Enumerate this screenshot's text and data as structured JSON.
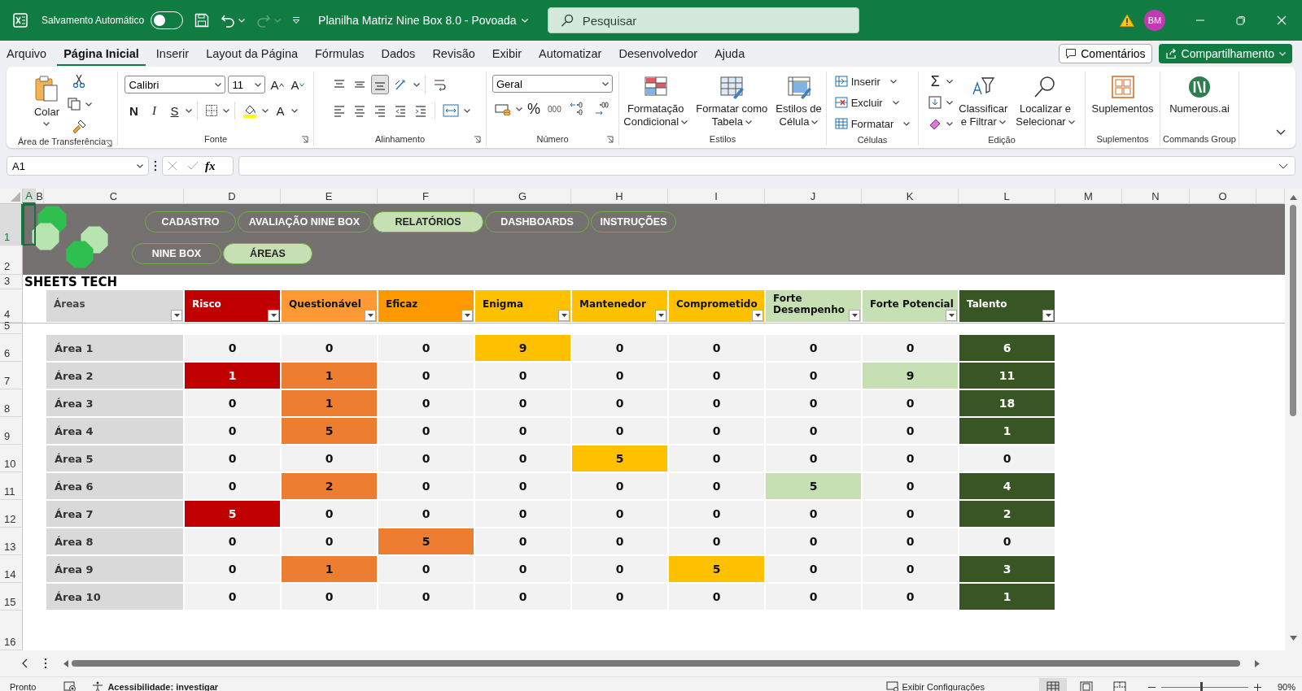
{
  "title_bar": {
    "autosave_label": "Salvamento Automático",
    "autosave_on": false,
    "redo_disabled": true,
    "document_title": "Planilha Matriz Nine Box 8.0 - Povoada",
    "search": {
      "placeholder": "Pesquisar"
    },
    "avatar": "BM"
  },
  "menu_tabs": [
    {
      "label": "Arquivo",
      "selected": false
    },
    {
      "label": "Página Inicial",
      "selected": true
    },
    {
      "label": "Inserir",
      "selected": false
    },
    {
      "label": "Layout da Página",
      "selected": false
    },
    {
      "label": "Fórmulas",
      "selected": false
    },
    {
      "label": "Dados",
      "selected": false
    },
    {
      "label": "Revisão",
      "selected": false
    },
    {
      "label": "Exibir",
      "selected": false
    },
    {
      "label": "Automatizar",
      "selected": false
    },
    {
      "label": "Desenvolvedor",
      "selected": false
    },
    {
      "label": "Ajuda",
      "selected": false
    }
  ],
  "comments_button": "Comentários",
  "share_button": "Compartilhamento",
  "ribbon": {
    "clipboard": {
      "label": "Área de Transferência",
      "paste": "Colar"
    },
    "font": {
      "label": "Fonte",
      "font_name": "Calibri",
      "font_size": "11",
      "grow": "A",
      "shrink": "A",
      "bold": "N",
      "italic": "I",
      "underline": "S",
      "font_color": "A"
    },
    "alignment": {
      "label": "Alinhamento",
      "vertical": [
        {
          "kind": "top",
          "selected": false
        },
        {
          "kind": "middle",
          "selected": false
        },
        {
          "kind": "bottom",
          "selected": true
        }
      ]
    },
    "number": {
      "label": "Número",
      "format": "Geral",
      "percent": "%",
      "thousands": "000"
    },
    "styles": {
      "label": "Estilos",
      "buttons": [
        {
          "kind": "conditional",
          "lines": [
            "Formatação",
            "Condicional"
          ]
        },
        {
          "kind": "table",
          "lines": [
            "Formatar como",
            "Tabela"
          ]
        },
        {
          "kind": "cell",
          "lines": [
            "Estilos de",
            "Célula"
          ]
        }
      ]
    },
    "cells": {
      "label": "Células",
      "buttons": [
        {
          "kind": "insert",
          "label": "Inserir"
        },
        {
          "kind": "delete",
          "label": "Excluir"
        },
        {
          "kind": "format",
          "label": "Formatar"
        }
      ]
    },
    "editing": {
      "label": "Edição",
      "sum": "Σ",
      "sort": [
        "Classificar",
        "e Filtrar"
      ],
      "find": [
        "Localizar e",
        "Selecionar"
      ]
    },
    "addins": {
      "label": "Suplementos",
      "button": "Suplementos"
    },
    "commands": {
      "label": "Commands Group",
      "button": "Numerous.ai"
    }
  },
  "formula_bar": {
    "name_box": "A1",
    "fx": "fx"
  },
  "sheet": {
    "column_headers": [
      {
        "label": "A",
        "selected": true
      },
      {
        "label": "B",
        "selected": false
      },
      {
        "label": "C",
        "selected": false
      },
      {
        "label": "D",
        "selected": false
      },
      {
        "label": "E",
        "selected": false
      },
      {
        "label": "F",
        "selected": false
      },
      {
        "label": "G",
        "selected": false
      },
      {
        "label": "H",
        "selected": false
      },
      {
        "label": "I",
        "selected": false
      },
      {
        "label": "J",
        "selected": false
      },
      {
        "label": "K",
        "selected": false
      },
      {
        "label": "L",
        "selected": false
      },
      {
        "label": "M",
        "selected": false
      },
      {
        "label": "N",
        "selected": false
      },
      {
        "label": "O",
        "selected": false
      }
    ],
    "row_headers": [
      {
        "label": "1",
        "selected": true
      },
      {
        "label": "2",
        "selected": false
      },
      {
        "label": "3",
        "selected": false
      },
      {
        "label": "4",
        "selected": false
      },
      {
        "label": "5",
        "selected": false
      },
      {
        "label": "6",
        "selected": false
      },
      {
        "label": "7",
        "selected": false
      },
      {
        "label": "8",
        "selected": false
      },
      {
        "label": "9",
        "selected": false
      },
      {
        "label": "10",
        "selected": false
      },
      {
        "label": "11",
        "selected": false
      },
      {
        "label": "12",
        "selected": false
      },
      {
        "label": "13",
        "selected": false
      },
      {
        "label": "14",
        "selected": false
      },
      {
        "label": "15",
        "selected": false
      },
      {
        "label": "16",
        "selected": false
      }
    ],
    "nav_primary": [
      {
        "label": "CADASTRO",
        "selected": false
      },
      {
        "label": "AVALIAÇÃO NINE BOX",
        "selected": false
      },
      {
        "label": "RELATÓRIOS",
        "selected": true
      },
      {
        "label": "DASHBOARDS",
        "selected": false
      },
      {
        "label": "INSTRUÇÕES",
        "selected": false
      }
    ],
    "nav_secondary": [
      {
        "label": "NINE BOX",
        "selected": false
      },
      {
        "label": "ÁREAS",
        "selected": true
      }
    ],
    "brand": "SHEETS TECH",
    "table": {
      "area_heading": {
        "label": "Áreas",
        "color": "#d9d9d9"
      },
      "columns": [
        {
          "label": "Risco",
          "color": "#c00000"
        },
        {
          "label": "Questionável",
          "color": "#ff9933"
        },
        {
          "label": "Eficaz",
          "color": "#ff9900"
        },
        {
          "label": "Enigma",
          "color": "#ffc000"
        },
        {
          "label": "Mantenedor",
          "color": "#ffc000"
        },
        {
          "label": "Comprometido",
          "color": "#ffc000"
        },
        {
          "label": "Forte Desempenho",
          "color": "#c6e0b4"
        },
        {
          "label": "Forte Potencial",
          "color": "#c6e0b4"
        },
        {
          "label": "Talento",
          "color": "#375623"
        }
      ],
      "rows": [
        {
          "area": "Área 1",
          "cells": [
            {
              "value": "0",
              "color": "#f2f2f2"
            },
            {
              "value": "0",
              "color": "#f2f2f2"
            },
            {
              "value": "0",
              "color": "#f2f2f2"
            },
            {
              "value": "9",
              "color": "#ffc000"
            },
            {
              "value": "0",
              "color": "#f2f2f2"
            },
            {
              "value": "0",
              "color": "#f2f2f2"
            },
            {
              "value": "0",
              "color": "#f2f2f2"
            },
            {
              "value": "0",
              "color": "#f2f2f2"
            },
            {
              "value": "6",
              "color": "#375623"
            }
          ]
        },
        {
          "area": "Área 2",
          "cells": [
            {
              "value": "1",
              "color": "#c00000"
            },
            {
              "value": "1",
              "color": "#ed7d31"
            },
            {
              "value": "0",
              "color": "#f2f2f2"
            },
            {
              "value": "0",
              "color": "#f2f2f2"
            },
            {
              "value": "0",
              "color": "#f2f2f2"
            },
            {
              "value": "0",
              "color": "#f2f2f2"
            },
            {
              "value": "0",
              "color": "#f2f2f2"
            },
            {
              "value": "9",
              "color": "#c6e0b4"
            },
            {
              "value": "11",
              "color": "#375623"
            }
          ]
        },
        {
          "area": "Área 3",
          "cells": [
            {
              "value": "0",
              "color": "#f2f2f2"
            },
            {
              "value": "1",
              "color": "#ed7d31"
            },
            {
              "value": "0",
              "color": "#f2f2f2"
            },
            {
              "value": "0",
              "color": "#f2f2f2"
            },
            {
              "value": "0",
              "color": "#f2f2f2"
            },
            {
              "value": "0",
              "color": "#f2f2f2"
            },
            {
              "value": "0",
              "color": "#f2f2f2"
            },
            {
              "value": "0",
              "color": "#f2f2f2"
            },
            {
              "value": "18",
              "color": "#375623"
            }
          ]
        },
        {
          "area": "Área 4",
          "cells": [
            {
              "value": "0",
              "color": "#f2f2f2"
            },
            {
              "value": "5",
              "color": "#ed7d31"
            },
            {
              "value": "0",
              "color": "#f2f2f2"
            },
            {
              "value": "0",
              "color": "#f2f2f2"
            },
            {
              "value": "0",
              "color": "#f2f2f2"
            },
            {
              "value": "0",
              "color": "#f2f2f2"
            },
            {
              "value": "0",
              "color": "#f2f2f2"
            },
            {
              "value": "0",
              "color": "#f2f2f2"
            },
            {
              "value": "1",
              "color": "#375623"
            }
          ]
        },
        {
          "area": "Área 5",
          "cells": [
            {
              "value": "0",
              "color": "#f2f2f2"
            },
            {
              "value": "0",
              "color": "#f2f2f2"
            },
            {
              "value": "0",
              "color": "#f2f2f2"
            },
            {
              "value": "0",
              "color": "#f2f2f2"
            },
            {
              "value": "5",
              "color": "#ffc000"
            },
            {
              "value": "0",
              "color": "#f2f2f2"
            },
            {
              "value": "0",
              "color": "#f2f2f2"
            },
            {
              "value": "0",
              "color": "#f2f2f2"
            },
            {
              "value": "0",
              "color": "#f2f2f2"
            }
          ]
        },
        {
          "area": "Área 6",
          "cells": [
            {
              "value": "0",
              "color": "#f2f2f2"
            },
            {
              "value": "2",
              "color": "#ed7d31"
            },
            {
              "value": "0",
              "color": "#f2f2f2"
            },
            {
              "value": "0",
              "color": "#f2f2f2"
            },
            {
              "value": "0",
              "color": "#f2f2f2"
            },
            {
              "value": "0",
              "color": "#f2f2f2"
            },
            {
              "value": "5",
              "color": "#c6e0b4"
            },
            {
              "value": "0",
              "color": "#f2f2f2"
            },
            {
              "value": "4",
              "color": "#375623"
            }
          ]
        },
        {
          "area": "Área 7",
          "cells": [
            {
              "value": "5",
              "color": "#c00000"
            },
            {
              "value": "0",
              "color": "#f2f2f2"
            },
            {
              "value": "0",
              "color": "#f2f2f2"
            },
            {
              "value": "0",
              "color": "#f2f2f2"
            },
            {
              "value": "0",
              "color": "#f2f2f2"
            },
            {
              "value": "0",
              "color": "#f2f2f2"
            },
            {
              "value": "0",
              "color": "#f2f2f2"
            },
            {
              "value": "0",
              "color": "#f2f2f2"
            },
            {
              "value": "2",
              "color": "#375623"
            }
          ]
        },
        {
          "area": "Área 8",
          "cells": [
            {
              "value": "0",
              "color": "#f2f2f2"
            },
            {
              "value": "0",
              "color": "#f2f2f2"
            },
            {
              "value": "5",
              "color": "#ed7d31"
            },
            {
              "value": "0",
              "color": "#f2f2f2"
            },
            {
              "value": "0",
              "color": "#f2f2f2"
            },
            {
              "value": "0",
              "color": "#f2f2f2"
            },
            {
              "value": "0",
              "color": "#f2f2f2"
            },
            {
              "value": "0",
              "color": "#f2f2f2"
            },
            {
              "value": "0",
              "color": "#f2f2f2"
            }
          ]
        },
        {
          "area": "Área 9",
          "cells": [
            {
              "value": "0",
              "color": "#f2f2f2"
            },
            {
              "value": "1",
              "color": "#ed7d31"
            },
            {
              "value": "0",
              "color": "#f2f2f2"
            },
            {
              "value": "0",
              "color": "#f2f2f2"
            },
            {
              "value": "0",
              "color": "#f2f2f2"
            },
            {
              "value": "5",
              "color": "#ffc000"
            },
            {
              "value": "0",
              "color": "#f2f2f2"
            },
            {
              "value": "0",
              "color": "#f2f2f2"
            },
            {
              "value": "3",
              "color": "#375623"
            }
          ]
        },
        {
          "area": "Área 10",
          "cells": [
            {
              "value": "0",
              "color": "#f2f2f2"
            },
            {
              "value": "0",
              "color": "#f2f2f2"
            },
            {
              "value": "0",
              "color": "#f2f2f2"
            },
            {
              "value": "0",
              "color": "#f2f2f2"
            },
            {
              "value": "0",
              "color": "#f2f2f2"
            },
            {
              "value": "0",
              "color": "#f2f2f2"
            },
            {
              "value": "0",
              "color": "#f2f2f2"
            },
            {
              "value": "0",
              "color": "#f2f2f2"
            },
            {
              "value": "1",
              "color": "#375623"
            }
          ]
        }
      ]
    }
  },
  "status_bar": {
    "status": "Pronto",
    "accessibility": "Acessibilidade: investigar",
    "display_settings": "Exibir Configurações",
    "views": [
      {
        "kind": "normal",
        "selected": true
      },
      {
        "kind": "page_layout",
        "selected": false
      },
      {
        "kind": "page_break",
        "selected": false
      }
    ],
    "zoom": {
      "level": 0.46,
      "reading": "90%"
    }
  }
}
